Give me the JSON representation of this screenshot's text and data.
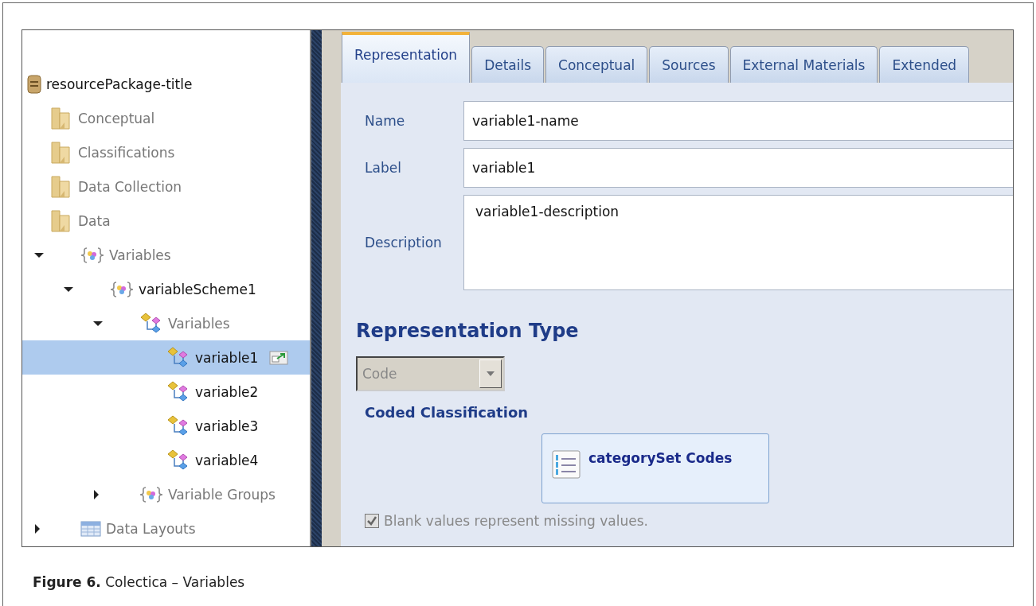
{
  "tree": [
    {
      "label": "resourcePackage-title",
      "kind": "package",
      "selected": false,
      "children": [
        {
          "label": "Conceptual",
          "kind": "folder",
          "selected": false
        },
        {
          "label": "Classifications",
          "kind": "folder",
          "selected": false
        },
        {
          "label": "Data Collection",
          "kind": "folder",
          "selected": false
        },
        {
          "label": "Data",
          "kind": "folder",
          "selected": false
        },
        {
          "label": "Variables",
          "kind": "braces",
          "expanded": true,
          "selected": false,
          "children": [
            {
              "label": "variableScheme1",
              "kind": "scheme",
              "expanded": true,
              "selected": false,
              "children": [
                {
                  "label": "Variables",
                  "kind": "variables",
                  "expanded": true,
                  "selected": false,
                  "children": [
                    {
                      "label": "variable1",
                      "kind": "variable",
                      "selected": true
                    },
                    {
                      "label": "variable2",
                      "kind": "variable",
                      "selected": false
                    },
                    {
                      "label": "variable3",
                      "kind": "variable",
                      "selected": false
                    },
                    {
                      "label": "variable4",
                      "kind": "variable",
                      "selected": false
                    }
                  ]
                },
                {
                  "label": "Variable Groups",
                  "kind": "braces",
                  "expanded": false,
                  "selected": false
                }
              ]
            }
          ]
        },
        {
          "label": "Data Layouts",
          "kind": "table",
          "expanded": false,
          "selected": false
        }
      ]
    }
  ],
  "tabs": [
    {
      "label": "Representation",
      "selected": true
    },
    {
      "label": "Details",
      "selected": false
    },
    {
      "label": "Conceptual",
      "selected": false
    },
    {
      "label": "Sources",
      "selected": false
    },
    {
      "label": "External Materials",
      "selected": false
    },
    {
      "label": "Extended",
      "selected": false
    }
  ],
  "fields": [
    {
      "label": "Name",
      "value": "variable1-name",
      "kind": "line"
    },
    {
      "label": "Label",
      "value": "variable1",
      "kind": "line"
    },
    {
      "label": "Description",
      "value": "variable1-description",
      "kind": "area"
    }
  ],
  "representation_type": {
    "heading": "Representation Type",
    "select": {
      "value": "Code",
      "disabled": true
    }
  },
  "coded_classification": {
    "heading": "Coded Classification",
    "card": "categorySet Codes"
  },
  "checkbox": {
    "label": "Blank values represent missing values.",
    "checked": true,
    "disabled": true
  },
  "caption": "**Figure 6.** Colectica – Variables"
}
